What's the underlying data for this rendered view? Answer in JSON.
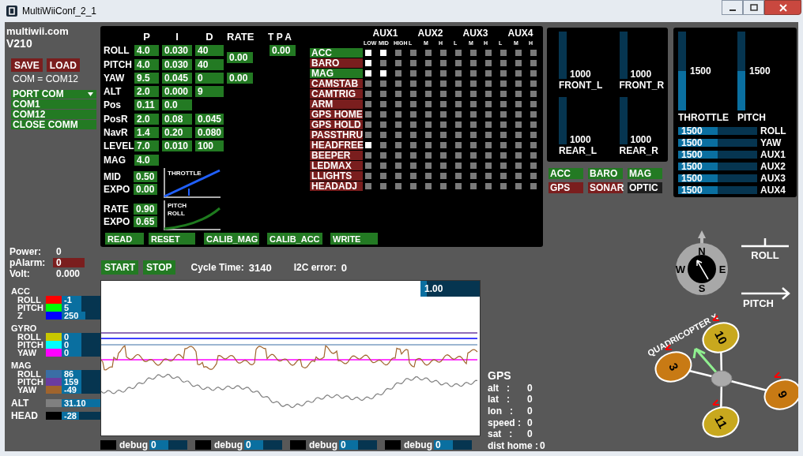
{
  "window": {
    "title": "MultiWiiConf_2_1"
  },
  "brand": {
    "site": "multiwii.com",
    "version": "V210"
  },
  "file_buttons": [
    {
      "label": "SAVE"
    },
    {
      "label": "LOAD"
    }
  ],
  "com_status": "COM = COM12",
  "port_menu": {
    "title": "PORT COM",
    "expanded": true,
    "items": [
      {
        "label": "COM1"
      },
      {
        "label": "COM12"
      },
      {
        "label": "CLOSE COMM"
      }
    ]
  },
  "pid": {
    "columns": [
      "P",
      "I",
      "D",
      "RATE",
      "T P A"
    ],
    "rows": [
      {
        "name": "ROLL",
        "p": "4.0",
        "i": "0.030",
        "d": "40"
      },
      {
        "name": "PITCH",
        "p": "4.0",
        "i": "0.030",
        "d": "40"
      },
      {
        "name": "YAW",
        "p": "9.5",
        "i": "0.045",
        "d": "0"
      },
      {
        "name": "ALT",
        "p": "2.0",
        "i": "0.000",
        "d": "9"
      },
      {
        "name": "Pos",
        "p": "0.11",
        "i": "0.0"
      },
      {
        "name": "PosR",
        "p": "2.0",
        "i": "0.08",
        "d": "0.045"
      },
      {
        "name": "NavR",
        "p": "1.4",
        "i": "0.20",
        "d": "0.080"
      },
      {
        "name": "LEVEL",
        "p": "7.0",
        "i": "0.010",
        "d": "100"
      },
      {
        "name": "MAG",
        "p": "4.0"
      }
    ],
    "rates": [
      {
        "value": "0.00"
      },
      {
        "value": "0.00"
      }
    ],
    "tpa": {
      "value": "0.00"
    }
  },
  "curves": [
    {
      "kind": "throttle",
      "title_lines": [
        "THROTTLE"
      ],
      "params": [
        {
          "name": "MID",
          "value": "0.50"
        },
        {
          "name": "EXPO",
          "value": "0.00"
        }
      ]
    },
    {
      "kind": "rate",
      "title_lines": [
        "PITCH",
        "ROLL"
      ],
      "params": [
        {
          "name": "RATE",
          "value": "0.90"
        },
        {
          "name": "EXPO",
          "value": "0.65"
        }
      ]
    }
  ],
  "actions": [
    {
      "label": "READ"
    },
    {
      "label": "RESET"
    },
    {
      "label": "CALIB_MAG"
    },
    {
      "label": "CALIB_ACC"
    },
    {
      "label": "WRITE"
    }
  ],
  "aux": {
    "channels": [
      {
        "name": "AUX1",
        "positions": [
          "LOW",
          "MID",
          "HIGH"
        ]
      },
      {
        "name": "AUX2",
        "positions": [
          "L",
          "M",
          "H"
        ]
      },
      {
        "name": "AUX3",
        "positions": [
          "L",
          "M",
          "H"
        ]
      },
      {
        "name": "AUX4",
        "positions": [
          "L",
          "M",
          "H"
        ]
      }
    ],
    "boxes": [
      {
        "name": "ACC",
        "active": true,
        "enabled": [
          true,
          true,
          false,
          false,
          false,
          false,
          false,
          false,
          false,
          false,
          false,
          false
        ]
      },
      {
        "name": "BARO",
        "active": false,
        "enabled": [
          true,
          false,
          false,
          false,
          false,
          false,
          false,
          false,
          false,
          false,
          false,
          false
        ]
      },
      {
        "name": "MAG",
        "active": true,
        "enabled": [
          true,
          true,
          false,
          false,
          false,
          false,
          false,
          false,
          false,
          false,
          false,
          false
        ]
      },
      {
        "name": "CAMSTAB",
        "active": false,
        "enabled": [
          false,
          false,
          false,
          false,
          false,
          false,
          false,
          false,
          false,
          false,
          false,
          false
        ]
      },
      {
        "name": "CAMTRIG",
        "active": false,
        "enabled": [
          false,
          false,
          false,
          false,
          false,
          false,
          false,
          false,
          false,
          false,
          false,
          false
        ]
      },
      {
        "name": "ARM",
        "active": false,
        "enabled": [
          false,
          false,
          false,
          false,
          false,
          false,
          false,
          false,
          false,
          false,
          false,
          false
        ]
      },
      {
        "name": "GPS HOME",
        "active": false,
        "enabled": [
          false,
          false,
          false,
          false,
          false,
          false,
          false,
          false,
          false,
          false,
          false,
          false
        ]
      },
      {
        "name": "GPS HOLD",
        "active": false,
        "enabled": [
          false,
          false,
          false,
          false,
          false,
          false,
          false,
          false,
          false,
          false,
          false,
          false
        ]
      },
      {
        "name": "PASSTHRU",
        "active": false,
        "enabled": [
          false,
          false,
          false,
          false,
          false,
          false,
          false,
          false,
          false,
          false,
          false,
          false
        ]
      },
      {
        "name": "HEADFREE",
        "active": false,
        "enabled": [
          true,
          false,
          false,
          false,
          false,
          false,
          false,
          false,
          false,
          false,
          false,
          false
        ]
      },
      {
        "name": "BEEPER",
        "active": false,
        "enabled": [
          false,
          false,
          false,
          false,
          false,
          false,
          false,
          false,
          false,
          false,
          false,
          false
        ]
      },
      {
        "name": "LEDMAX",
        "active": false,
        "enabled": [
          false,
          false,
          false,
          false,
          false,
          false,
          false,
          false,
          false,
          false,
          false,
          false
        ]
      },
      {
        "name": "LLIGHTS",
        "active": false,
        "enabled": [
          false,
          false,
          false,
          false,
          false,
          false,
          false,
          false,
          false,
          false,
          false,
          false
        ]
      },
      {
        "name": "HEADADJ",
        "active": false,
        "enabled": [
          false,
          false,
          false,
          false,
          false,
          false,
          false,
          false,
          false,
          false,
          false,
          false
        ]
      }
    ]
  },
  "motors": [
    {
      "name": "FRONT_L",
      "value": "1000",
      "level": 0
    },
    {
      "name": "FRONT_R",
      "value": "1000",
      "level": 0
    },
    {
      "name": "REAR_L",
      "value": "1000",
      "level": 0
    },
    {
      "name": "REAR_R",
      "value": "1000",
      "level": 0
    }
  ],
  "sensor_badges": [
    {
      "label": "ACC",
      "color": "#237a23"
    },
    {
      "label": "BARO",
      "color": "#237a23"
    },
    {
      "label": "MAG",
      "color": "#237a23"
    },
    {
      "label": "GPS",
      "color": "#7a1e1e"
    },
    {
      "label": "SONAR",
      "color": "#7a1e1e"
    },
    {
      "label": "OPTIC",
      "color": "#1e1e1e"
    }
  ],
  "rc": {
    "sticks": [
      {
        "name": "THROTTLE",
        "value": "1500",
        "level": 0.5
      },
      {
        "name": "PITCH",
        "value": "1500",
        "level": 0.5
      }
    ],
    "channels": [
      {
        "name": "ROLL",
        "value": "1500",
        "level": 0.5
      },
      {
        "name": "YAW",
        "value": "1500",
        "level": 0.5
      },
      {
        "name": "AUX1",
        "value": "1500",
        "level": 0.5
      },
      {
        "name": "AUX2",
        "value": "1500",
        "level": 0.5
      },
      {
        "name": "AUX3",
        "value": "1500",
        "level": 0.5
      },
      {
        "name": "AUX4",
        "value": "1500",
        "level": 0.5
      }
    ]
  },
  "power": [
    {
      "label": "Power:",
      "value": "0",
      "kind": "text"
    },
    {
      "label": "pAlarm:",
      "value": "0",
      "kind": "field"
    },
    {
      "label": "Volt:",
      "value": "0.000",
      "kind": "text"
    }
  ],
  "sensor_groups": [
    {
      "title": "ACC",
      "axes": [
        {
          "name": "ROLL",
          "value": "-1",
          "color": "#ff0000",
          "level": 0.5
        },
        {
          "name": "PITCH",
          "value": "5",
          "color": "#00ff00",
          "level": 0.5
        },
        {
          "name": "Z",
          "value": "250",
          "color": "#0000ff",
          "level": 0.62
        }
      ]
    },
    {
      "title": "GYRO",
      "axes": [
        {
          "name": "ROLL",
          "value": "0",
          "color": "#c8c800",
          "level": 0.5
        },
        {
          "name": "PITCH",
          "value": "0",
          "color": "#00ffff",
          "level": 0.5
        },
        {
          "name": "YAW",
          "value": "0",
          "color": "#ff00ff",
          "level": 0.5
        }
      ]
    },
    {
      "title": "MAG",
      "axes": [
        {
          "name": "ROLL",
          "value": "86",
          "color": "#3a6ea5",
          "level": 0.5
        },
        {
          "name": "PITCH",
          "value": "159",
          "color": "#6a3ca0",
          "level": 0.5
        },
        {
          "name": "YAW",
          "value": "-49",
          "color": "#a0642d",
          "level": 0.5
        }
      ]
    }
  ],
  "readouts": [
    {
      "name": "ALT",
      "value": "31.10",
      "color": "#808080",
      "level": 1
    },
    {
      "name": "HEAD",
      "value": "-28",
      "color": "#000000",
      "level": 0.44
    }
  ],
  "monitor": {
    "buttons": [
      {
        "label": "START"
      },
      {
        "label": "STOP"
      }
    ],
    "stats": [
      {
        "label": "Cycle Time:",
        "value": "3140"
      },
      {
        "label": "I2C error:",
        "value": "0"
      }
    ]
  },
  "graph": {
    "scale": {
      "value": "1.00",
      "level": 0.1
    }
  },
  "debug": [
    {
      "label": "debug",
      "value": "0",
      "level": 0.5
    },
    {
      "label": "debug",
      "value": "0",
      "level": 0.5
    },
    {
      "label": "debug",
      "value": "0",
      "level": 0.5
    },
    {
      "label": "debug",
      "value": "0",
      "level": 0.5
    }
  ],
  "gps": {
    "title": "GPS",
    "rows": [
      {
        "label": "alt   :",
        "value": "0"
      },
      {
        "label": "lat   :",
        "value": "0"
      },
      {
        "label": "lon   :",
        "value": "0"
      },
      {
        "label": "speed :",
        "value": "0"
      },
      {
        "label": "sat   :",
        "value": "0"
      },
      {
        "label": "dist home :",
        "value": "0"
      }
    ]
  },
  "attitude": {
    "compass": [
      "N",
      "E",
      "S",
      "W"
    ],
    "roll_label": "ROLL",
    "pitch_label": "PITCH",
    "model": "QUADRICOPTER X",
    "motors": [
      "10",
      "9",
      "11",
      "3"
    ]
  }
}
